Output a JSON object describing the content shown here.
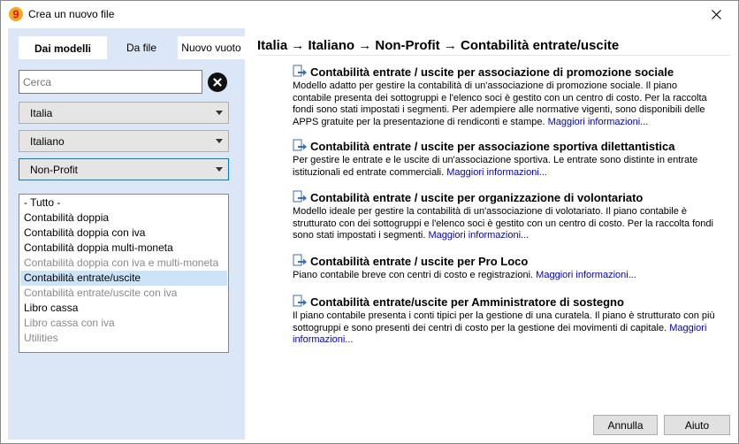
{
  "window": {
    "title": "Crea un nuovo file",
    "app_icon": "banana-app-icon",
    "close_icon": "close-icon"
  },
  "sidebar": {
    "tabs": [
      {
        "label": "Dai modelli",
        "active": true
      },
      {
        "label": "Da file",
        "active": false
      },
      {
        "label": "Nuovo vuoto",
        "active": false
      }
    ],
    "search": {
      "placeholder": "Cerca",
      "value": ""
    },
    "country": {
      "value": "Italia"
    },
    "language": {
      "value": "Italiano"
    },
    "category": {
      "value": "Non-Profit"
    },
    "list": [
      {
        "label": "- Tutto -",
        "enabled": true,
        "selected": false
      },
      {
        "label": "Contabilità doppia",
        "enabled": true,
        "selected": false
      },
      {
        "label": "Contabilità doppia con iva",
        "enabled": true,
        "selected": false
      },
      {
        "label": "Contabilità doppia multi-moneta",
        "enabled": true,
        "selected": false
      },
      {
        "label": "Contabilità doppia con iva e multi-moneta",
        "enabled": false,
        "selected": false
      },
      {
        "label": "Contabilità entrate/uscite",
        "enabled": true,
        "selected": true
      },
      {
        "label": "Contabilità entrate/uscite con iva",
        "enabled": false,
        "selected": false
      },
      {
        "label": "Libro cassa",
        "enabled": true,
        "selected": false
      },
      {
        "label": "Libro cassa con iva",
        "enabled": false,
        "selected": false
      },
      {
        "label": "Utilities",
        "enabled": false,
        "selected": false
      }
    ]
  },
  "main": {
    "heading": "Italia → Italiano → Non-Profit → Contabilità entrate/uscite",
    "more_label": "Maggiori informazioni...",
    "entries": [
      {
        "title": "Contabilità entrate / uscite per associazione di promozione sociale",
        "description": "Modello adatto per gestire la contabilità di un'associazione di promozione sociale. Il piano contabile presenta dei sottogruppi e l'elenco soci è gestito con un centro di costo. Per la raccolta fondi sono stati impostati i segmenti. Per adempiere alle normative vigenti, sono disponibili delle APPS gratuite per la presentazione di rendiconti e stampe."
      },
      {
        "title": "Contabilità entrate / uscite per associazione sportiva dilettantistica",
        "description": "Per gestire le entrate e le uscite di un'associazione sportiva. Le entrate sono distinte in entrate istituzionali ed entrate commerciali."
      },
      {
        "title": "Contabilità entrate / uscite per organizzazione di volontariato",
        "description": "Modello ideale per gestire la contabilità di un'associazione di volotariato. Il piano contabile è strutturato con dei sottogruppi e l'elenco soci è gestito con un centro di costo. Per la raccolta fondi sono stati impostati i segmenti."
      },
      {
        "title": "Contabilità entrate / uscite per Pro Loco",
        "description": "Piano contabile breve con centri di costo e registrazioni."
      },
      {
        "title": "Contabilità entrate/uscite per Amministratore di sostegno",
        "description": "Il piano contabile presenta i conti tipici per la gestione di una curatela. Il piano è strutturato con più sottogruppi e sono presenti dei centri di costo per la gestione dei movimenti di capitale."
      }
    ]
  },
  "footer": {
    "cancel_label": "Annulla",
    "help_label": "Aiuto"
  },
  "colors": {
    "sidebar_bg": "#dbe6f7",
    "selected_bg": "#cce4f7",
    "link": "#0000cc",
    "focus_border": "#0078d7"
  }
}
